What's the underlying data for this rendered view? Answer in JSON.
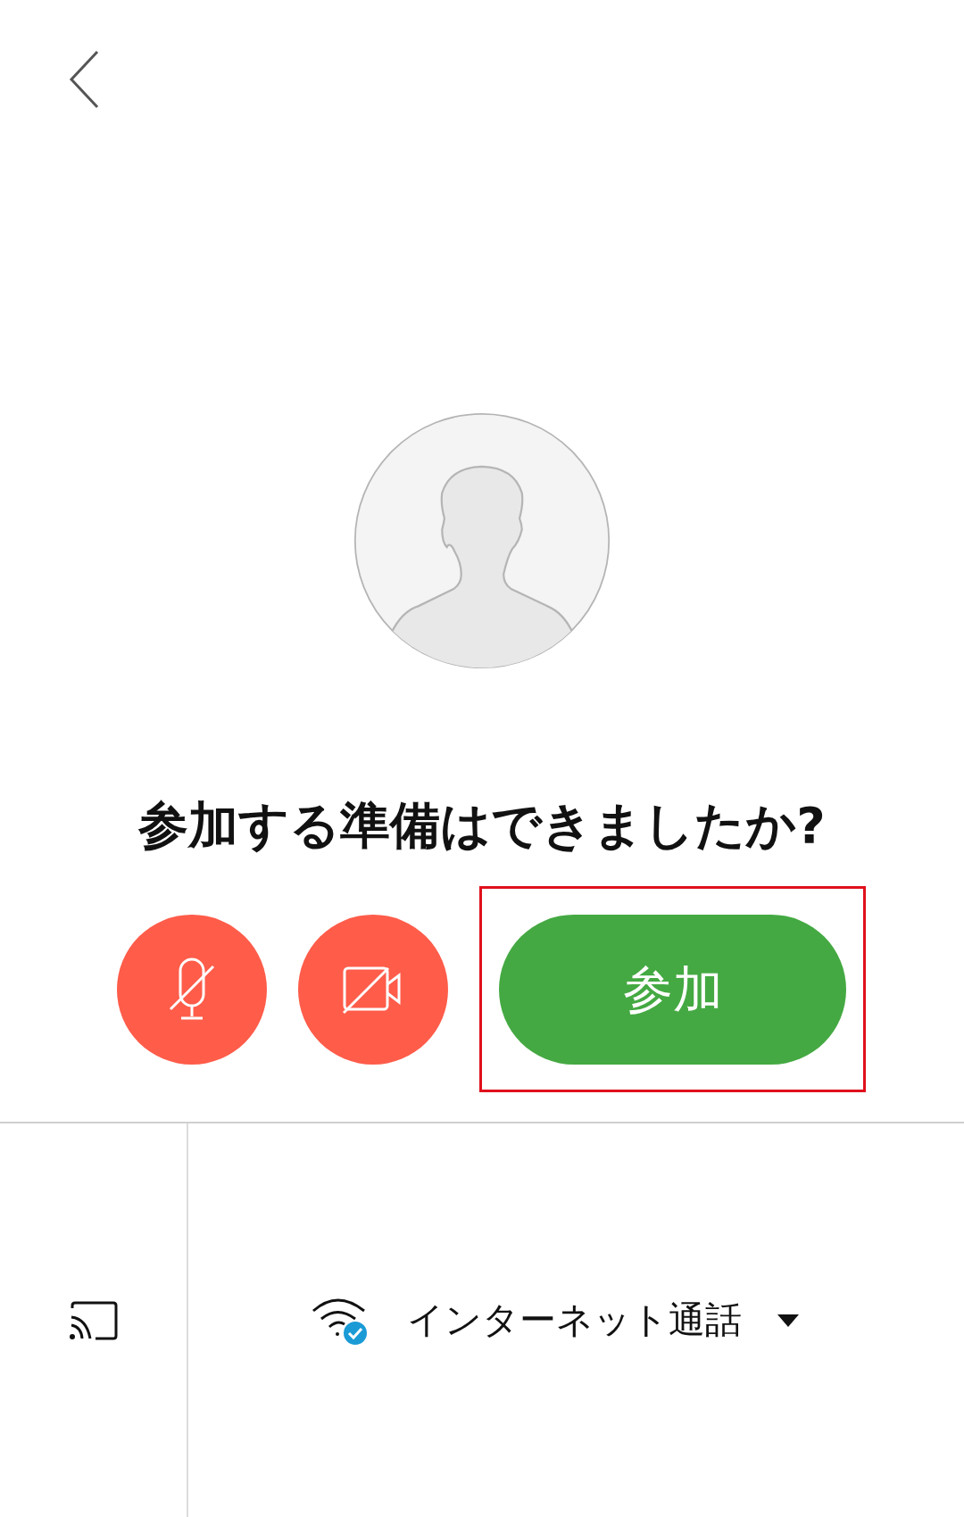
{
  "prompt": "参加する準備はできましたか?",
  "controls": {
    "microphone": {
      "muted": true
    },
    "camera": {
      "on": false
    },
    "join_button": {
      "label": "参加",
      "highlighted": true
    }
  },
  "bottom_bar": {
    "connection": {
      "label": "インターネット通話",
      "connected": true
    }
  }
}
